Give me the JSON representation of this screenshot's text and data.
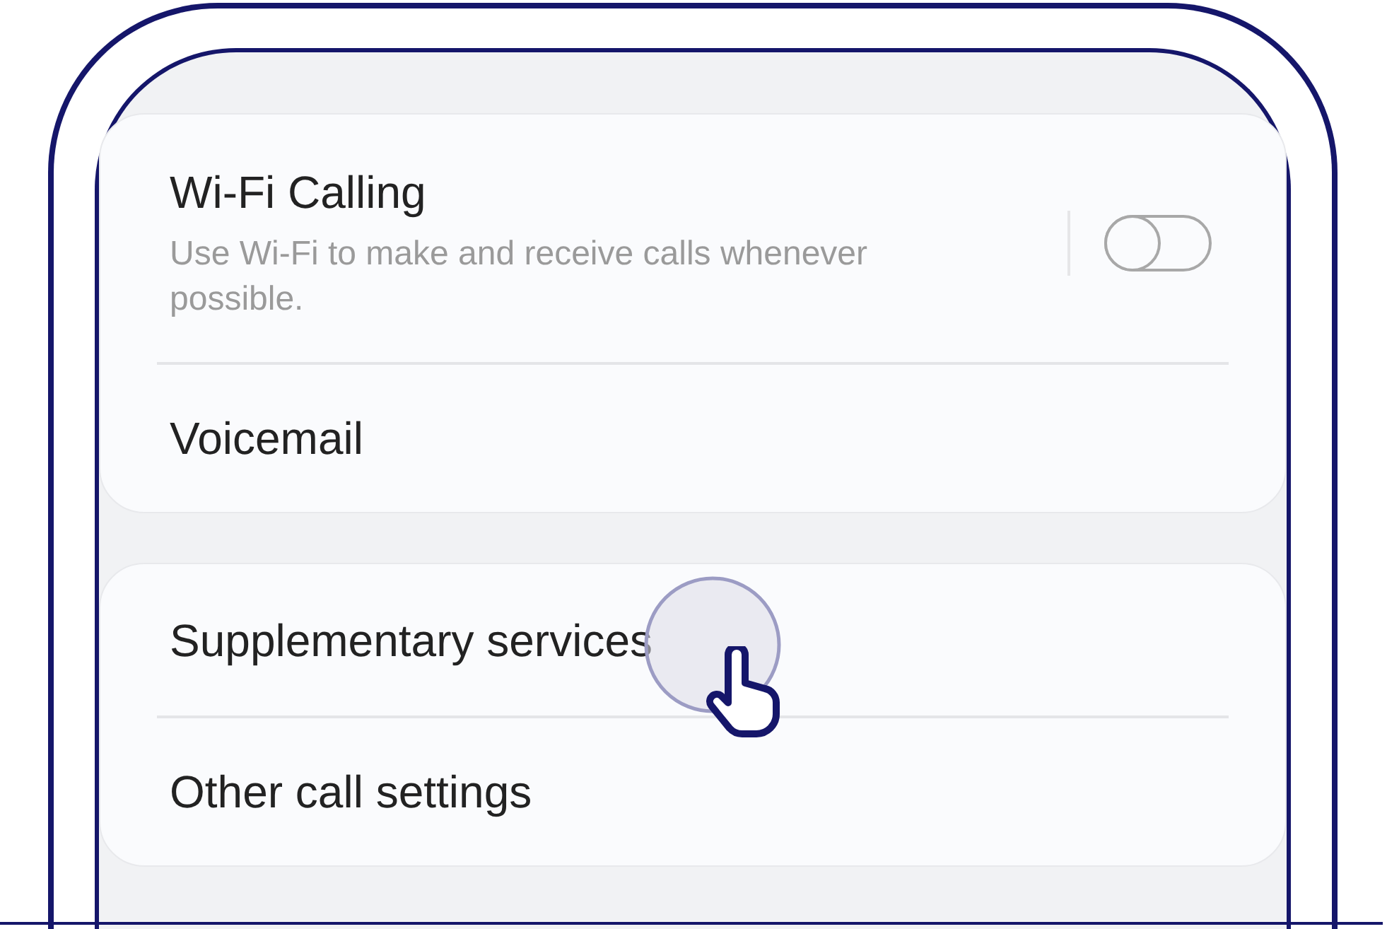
{
  "groups": [
    {
      "items": [
        {
          "kind": "toggle",
          "title": "Wi-Fi Calling",
          "subtitle": "Use Wi-Fi to make and receive calls whenever possible.",
          "on": false
        },
        {
          "kind": "link",
          "title": "Voicemail"
        }
      ]
    },
    {
      "items": [
        {
          "kind": "link",
          "title": "Supplementary services"
        },
        {
          "kind": "link",
          "title": "Other call settings"
        }
      ]
    }
  ]
}
